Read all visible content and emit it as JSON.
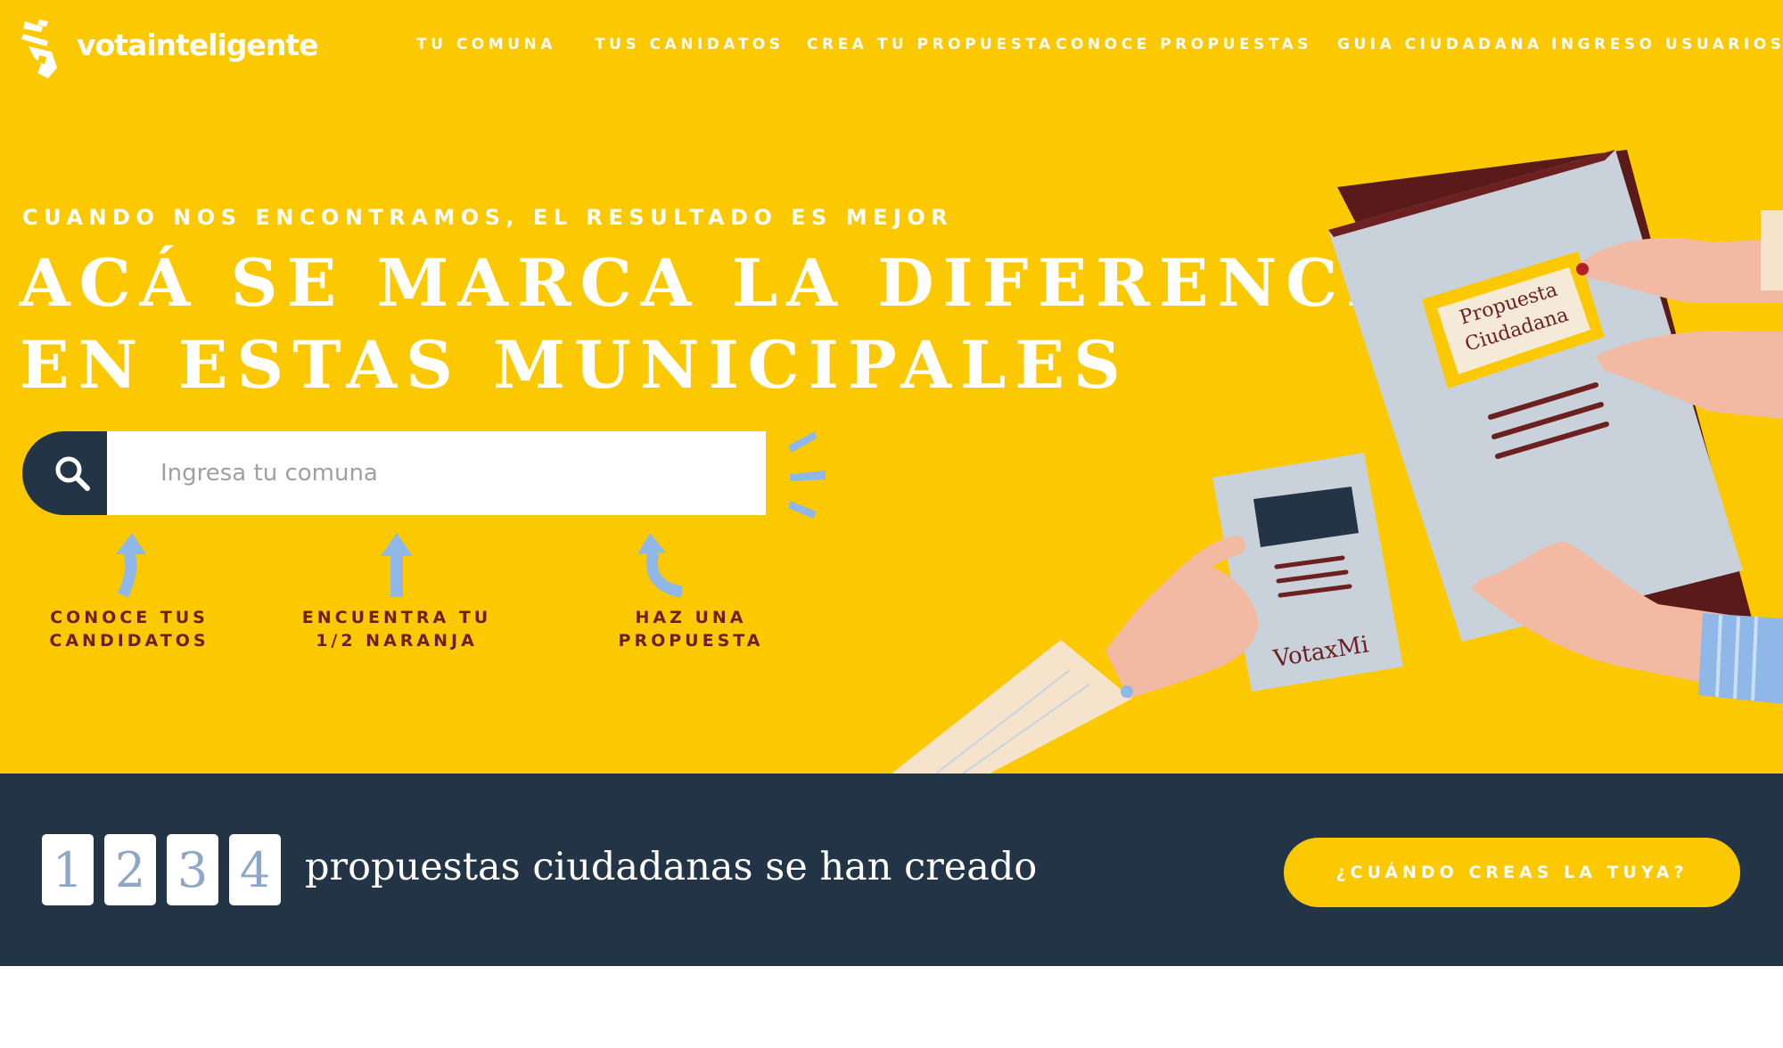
{
  "brand": {
    "name": "votainteligente"
  },
  "nav": {
    "items": [
      {
        "label": "TU COMUNA"
      },
      {
        "label": "TUS CANIDATOS"
      },
      {
        "label": "CREA TU PROPUESTA"
      },
      {
        "label": "CONOCE PROPUESTAS"
      },
      {
        "label": "GUIA CIUDADANA"
      },
      {
        "label": "INGRESO USUARIOS"
      }
    ]
  },
  "hero": {
    "subtitle": "CUANDO NOS ENCONTRAMOS, EL RESULTADO ES MEJOR",
    "headline_line1": "ACÁ SE MARCA LA DIFERENCIA",
    "headline_line2": "EN ESTAS MUNICIPALES",
    "search": {
      "placeholder": "Ingresa tu comuna",
      "value": "",
      "icon": "search-icon"
    },
    "hints": [
      {
        "label": "CONOCE TUS\nCANDIDATOS"
      },
      {
        "label": "ENCUENTRA TU\n1/2 NARANJA"
      },
      {
        "label": "HAZ UNA\nPROPUESTA"
      }
    ],
    "illustration": {
      "folder_label_line1": "Propuesta",
      "folder_label_line2": "Ciudadana",
      "card_label": "VotaxMi"
    }
  },
  "counter": {
    "digits": [
      "1",
      "2",
      "3",
      "4"
    ],
    "text": "propuestas ciudadanas se han creado",
    "cta_label": "¿CUÁNDO CREAS LA TUYA?"
  },
  "colors": {
    "brand_yellow": "#fcc800",
    "navy": "#233447",
    "maroon": "#6d2020",
    "light_blue": "#8fb8e8"
  }
}
